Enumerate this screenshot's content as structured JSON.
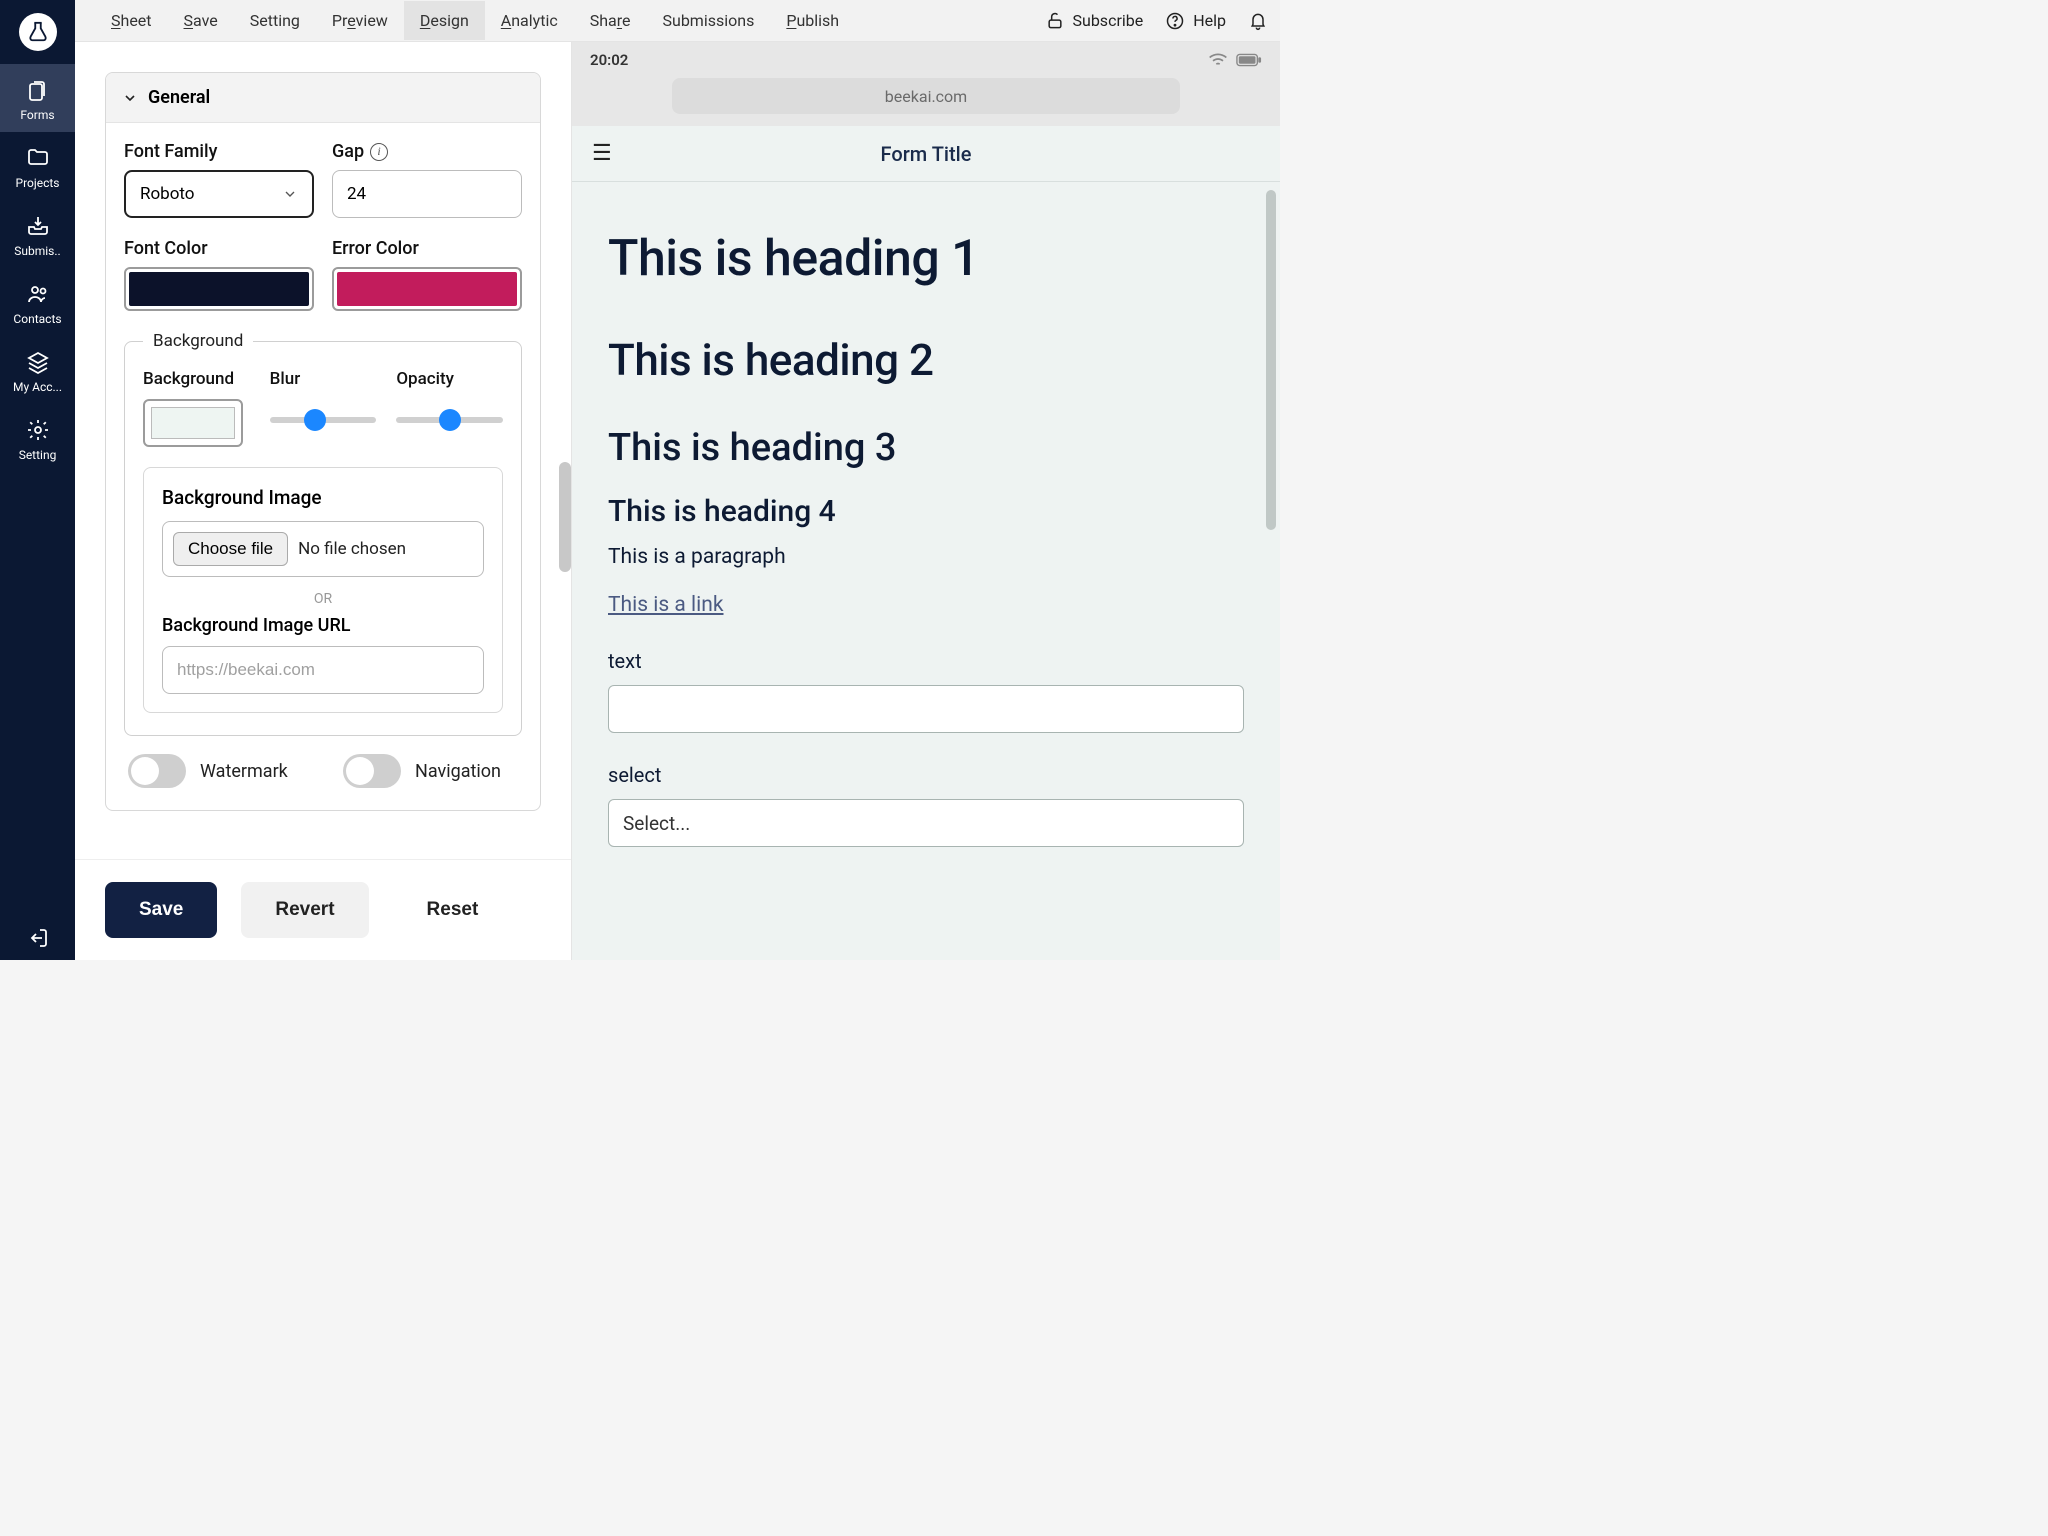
{
  "sidebar": {
    "items": [
      {
        "label": "Forms"
      },
      {
        "label": "Projects"
      },
      {
        "label": "Submis.."
      },
      {
        "label": "Contacts"
      },
      {
        "label": "My Acc..."
      },
      {
        "label": "Setting"
      }
    ]
  },
  "topmenu": {
    "items": [
      "Sheet",
      "Save",
      "Setting",
      "Preview",
      "Design",
      "Analytic",
      "Share",
      "Submissions",
      "Publish"
    ],
    "subscribe": "Subscribe",
    "help": "Help"
  },
  "design": {
    "accordion_title": "General",
    "font_family_label": "Font Family",
    "font_family_value": "Roboto",
    "gap_label": "Gap",
    "gap_value": "24",
    "font_color_label": "Font Color",
    "font_color_value": "#0c122a",
    "error_color_label": "Error Color",
    "error_color_value": "#c21c5c",
    "background_legend": "Background",
    "background_col_label": "Background",
    "blur_label": "Blur",
    "opacity_label": "Opacity",
    "bg_color_value": "#edf4f1",
    "blur_value": 40,
    "opacity_value": 50,
    "bg_image_label": "Background Image",
    "choose_file": "Choose file",
    "file_status": "No file chosen",
    "or_text": "OR",
    "bg_url_label": "Background Image URL",
    "bg_url_placeholder": "https://beekai.com",
    "watermark_label": "Watermark",
    "navigation_label": "Navigation"
  },
  "footer": {
    "save": "Save",
    "revert": "Revert",
    "reset": "Reset"
  },
  "device": {
    "time": "20:02",
    "url": "beekai.com"
  },
  "preview": {
    "form_title": "Form Title",
    "h1": "This is heading 1",
    "h2": "This is heading 2",
    "h3": "This is heading 3",
    "h4": "This is heading 4",
    "para": "This is a paragraph",
    "link": "This is a link",
    "text_label": "text",
    "select_label": "select",
    "select_placeholder": "Select..."
  }
}
